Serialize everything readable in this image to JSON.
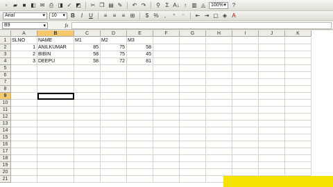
{
  "toolbar": {
    "zoom": "100%",
    "font_name": "Arial",
    "font_size": "10",
    "bold": "B",
    "italic": "I",
    "underline": "U",
    "currency": "$",
    "percent": "%",
    "sum": "Σ",
    "sort": "A↓",
    "fill": "A"
  },
  "formula_bar": {
    "name_box": "B9",
    "fx": "fx",
    "value": ""
  },
  "grid": {
    "columns": [
      "A",
      "B",
      "C",
      "D",
      "E",
      "F",
      "G",
      "H",
      "I",
      "J",
      "K"
    ],
    "active_cell": "B9",
    "rows": [
      {
        "n": "1",
        "A": "SLNO",
        "B": "NAME",
        "C": "M1",
        "D": "M2",
        "E": "M3"
      },
      {
        "n": "2",
        "A": "1",
        "B": "ANILKUMAR",
        "C": "85",
        "D": "75",
        "E": "58"
      },
      {
        "n": "3",
        "A": "2",
        "B": "BIBIN",
        "C": "58",
        "D": "75",
        "E": "45"
      },
      {
        "n": "4",
        "A": "3",
        "B": "DEEPU",
        "C": "58",
        "D": "72",
        "E": "81"
      },
      {
        "n": "5"
      },
      {
        "n": "6"
      },
      {
        "n": "7"
      },
      {
        "n": "8"
      },
      {
        "n": "9"
      },
      {
        "n": "10"
      },
      {
        "n": "11"
      },
      {
        "n": "12"
      },
      {
        "n": "13"
      },
      {
        "n": "14"
      },
      {
        "n": "15"
      },
      {
        "n": "16"
      },
      {
        "n": "17"
      },
      {
        "n": "18"
      },
      {
        "n": "19"
      },
      {
        "n": "20"
      },
      {
        "n": "21"
      }
    ]
  },
  "colors": {
    "selected_header": "#f5c86b",
    "brand_bg": "#f4e300",
    "brand_text": "#d01010"
  }
}
